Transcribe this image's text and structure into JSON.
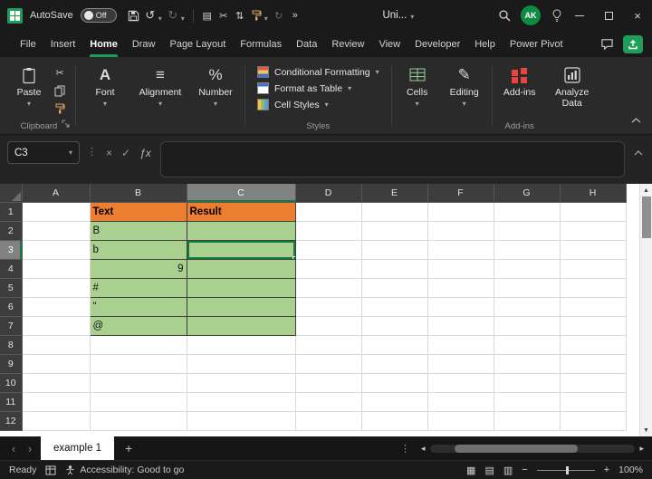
{
  "colors": {
    "orange": "#ED7D31",
    "green": "#A9D08E",
    "selection_green": "#107C41",
    "accent_green": "#1E9E5A",
    "addin_red": "#E8453C"
  },
  "icons": {
    "undo": "↺",
    "redo": "↻",
    "chevron_down": "▾",
    "chevron_up": "▴",
    "clipboard": "▤",
    "cut": "✂",
    "sort": "⇅",
    "overflow": "»",
    "close": "×",
    "cancel": "×",
    "check": "✓",
    "fx": "ƒx",
    "dots": "⋮",
    "prev": "‹",
    "next": "›",
    "add_sheet": "+",
    "scroll_left": "◂",
    "scroll_right": "▸",
    "scroll_up": "▲",
    "scroll_down": "▼",
    "view_normal": "▦",
    "view_layout": "▤",
    "view_break": "▥",
    "zoom_out": "−",
    "zoom_in": "+",
    "font": "A",
    "alignment": "≡",
    "number": "%",
    "editing": "✎"
  },
  "titlebar": {
    "autosave_label": "AutoSave",
    "autosave_state": "Off",
    "doc_title": "Uni...",
    "avatar_initials": "AK"
  },
  "menu": {
    "tabs": [
      {
        "label": "File",
        "active": false
      },
      {
        "label": "Insert",
        "active": false
      },
      {
        "label": "Home",
        "active": true
      },
      {
        "label": "Draw",
        "active": false
      },
      {
        "label": "Page Layout",
        "active": false
      },
      {
        "label": "Formulas",
        "active": false
      },
      {
        "label": "Data",
        "active": false
      },
      {
        "label": "Review",
        "active": false
      },
      {
        "label": "View",
        "active": false
      },
      {
        "label": "Developer",
        "active": false
      },
      {
        "label": "Help",
        "active": false
      },
      {
        "label": "Power Pivot",
        "active": false
      }
    ]
  },
  "ribbon": {
    "paste": "Paste",
    "font": "Font",
    "alignment": "Alignment",
    "number": "Number",
    "styles_items": [
      {
        "label": "Conditional Formatting"
      },
      {
        "label": "Format as Table"
      },
      {
        "label": "Cell Styles"
      }
    ],
    "cells": "Cells",
    "editing": "Editing",
    "addins": "Add-ins",
    "analyze": "Analyze Data",
    "group_clipboard": "Clipboard",
    "group_styles": "Styles",
    "group_addins": "Add-ins"
  },
  "formula_bar": {
    "name_box": "C3",
    "formula": ""
  },
  "grid": {
    "columns": [
      "A",
      "B",
      "C",
      "D",
      "E",
      "F",
      "G",
      "H"
    ],
    "row_count": 12,
    "selected_cell": "C3",
    "selected_column": "C",
    "selected_row": "3",
    "cells": [
      {
        "col": "B",
        "row": 1,
        "text": "Text",
        "type": "title"
      },
      {
        "col": "C",
        "row": 1,
        "text": "Result",
        "type": "title"
      },
      {
        "col": "B",
        "row": 2,
        "text": "B",
        "type": "green"
      },
      {
        "col": "C",
        "row": 2,
        "text": "",
        "type": "green"
      },
      {
        "col": "B",
        "row": 3,
        "text": "b",
        "type": "green"
      },
      {
        "col": "C",
        "row": 3,
        "text": "",
        "type": "green"
      },
      {
        "col": "B",
        "row": 4,
        "text": "9",
        "type": "green num"
      },
      {
        "col": "C",
        "row": 4,
        "text": "",
        "type": "green"
      },
      {
        "col": "B",
        "row": 5,
        "text": "#",
        "type": "green"
      },
      {
        "col": "C",
        "row": 5,
        "text": "",
        "type": "green"
      },
      {
        "col": "B",
        "row": 6,
        "text": "\"",
        "type": "green"
      },
      {
        "col": "C",
        "row": 6,
        "text": "",
        "type": "green"
      },
      {
        "col": "B",
        "row": 7,
        "text": "@",
        "type": "green"
      },
      {
        "col": "C",
        "row": 7,
        "text": "",
        "type": "green"
      }
    ]
  },
  "sheet_tabs": {
    "tabs": [
      {
        "label": "example 1",
        "active": true
      }
    ]
  },
  "status_bar": {
    "ready": "Ready",
    "accessibility": "Accessibility: Good to go",
    "zoom_level": "100%"
  }
}
